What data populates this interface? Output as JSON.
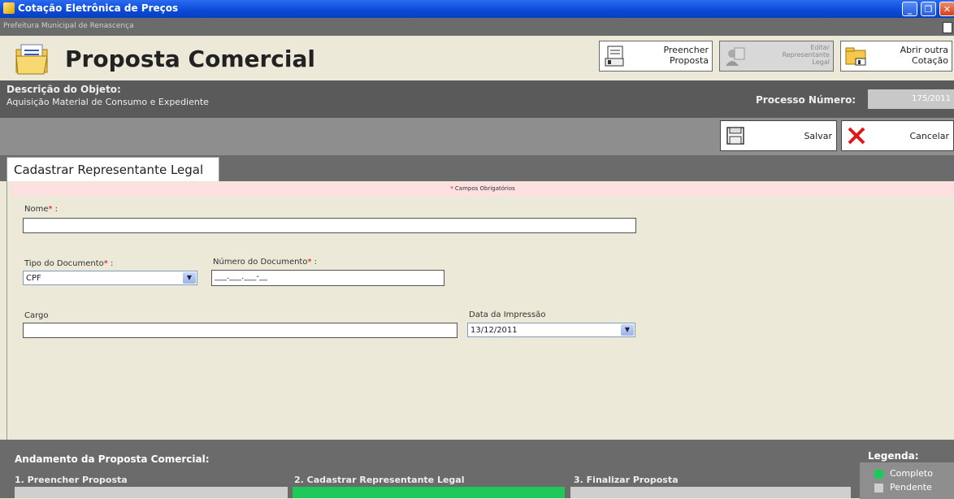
{
  "window": {
    "title": "Cotação Eletrônica de Preços",
    "subtitle": "Prefeitura Municipal de Renascença"
  },
  "header": {
    "title": "Proposta Comercial",
    "buttons": [
      {
        "label": "Preencher\nProposta",
        "icon": "form-icon",
        "enabled": true
      },
      {
        "label": "Editar\nRepresentante\nLegal",
        "icon": "representative-icon",
        "enabled": false
      },
      {
        "label": "Abrir outra\nCotação",
        "icon": "folder-icon",
        "enabled": true
      }
    ]
  },
  "object": {
    "label": "Descrição do Objeto:",
    "value": "Aquisição Material de Consumo e Expediente",
    "process_label": "Processo Número:",
    "process_value": "175/2011"
  },
  "actions": {
    "save": "Salvar",
    "cancel": "Cancelar"
  },
  "tab": {
    "label": "Cadastrar Representante Legal"
  },
  "required_note": {
    "star": "*",
    "text": "Campos Obrigatórios"
  },
  "form": {
    "name": {
      "label": "Nome",
      "star": "*",
      "suffix": " :",
      "value": ""
    },
    "doc_type": {
      "label": "Tipo do Documento",
      "star": "*",
      "suffix": " :",
      "value": "CPF"
    },
    "doc_number": {
      "label": "Número do Documento",
      "star": "*",
      "suffix": " :",
      "value": "___.___.___-__"
    },
    "cargo": {
      "label": "Cargo",
      "value": ""
    },
    "print_date": {
      "label": "Data da Impressão",
      "value": "13/12/2011"
    }
  },
  "progress": {
    "title": "Andamento da Proposta Comercial:",
    "steps": [
      {
        "label": "1. Preencher Proposta",
        "status": "pending"
      },
      {
        "label": "2. Cadastrar Representante Legal",
        "status": "complete"
      },
      {
        "label": "3. Finalizar Proposta",
        "status": "pending"
      }
    ]
  },
  "legend": {
    "title": "Legenda:",
    "items": [
      {
        "label": "Completo",
        "color": "#1ec85a"
      },
      {
        "label": "Pendente",
        "color": "#cfcfcf"
      }
    ]
  }
}
